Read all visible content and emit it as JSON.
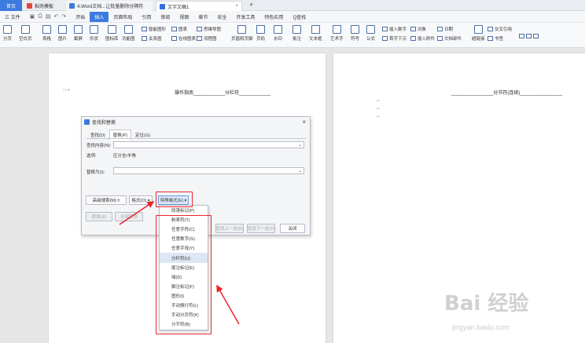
{
  "tabs": {
    "home": "首页",
    "t1": "稻壳模板",
    "t2": "4.Word文档...让批量删除分隔符",
    "t3": "文字文稿1",
    "new_tab": "+"
  },
  "menu": {
    "file": "三 文件",
    "items": [
      "开始",
      "插入",
      "页面布局",
      "引用",
      "审阅",
      "视图",
      "章节",
      "安全",
      "开发工具",
      "特色应用"
    ],
    "active": "插入",
    "search": "Q查找"
  },
  "ribbon": {
    "big": [
      "分页",
      "空白页",
      "表格",
      "图片",
      "截屏",
      "形状",
      "图标库",
      "功能图",
      "页眉和页脚",
      "页码",
      "水印",
      "批注",
      "文本框",
      "艺术字",
      "符号",
      "公式"
    ],
    "small": [
      "智能图形",
      "图表",
      "思维导图",
      "关系图",
      "在线图表",
      "流程图",
      "插入数字",
      "对象",
      "首字下沉",
      "插入附件",
      "日期",
      "文档部件",
      "超链接",
      "书签",
      "交叉引用"
    ]
  },
  "document": {
    "left_title": "操作指南____________分栏符____________",
    "right_title": "________________分节符(连续)________________"
  },
  "dialog": {
    "title": "查找和替换",
    "tabs": [
      "查找(D)",
      "替换(P)",
      "定位(G)"
    ],
    "active_tab": "替换(P)",
    "find_label": "查找内容(N):",
    "options_label": "选项:",
    "options_value": "区分全/半角",
    "replace_label": "替换为(I):",
    "buttons": {
      "advanced": "高级搜索(M) ±",
      "format": "格式(O) ▾",
      "special": "特殊格式(E) ▾",
      "replace": "替换(R)",
      "replace_all": "全部替换",
      "find_prev": "查找上一处(B)",
      "find_next": "查找下一处(F)",
      "close": "关闭"
    }
  },
  "special_menu": {
    "items": [
      "段落标记(P)",
      "制表符(T)",
      "任意字符(C)",
      "任意数字(G)",
      "任意字母(Y)",
      "分栏符(U)",
      "尾注标记(E)",
      "域(D)",
      "脚注标记(F)",
      "图形(I)",
      "手动换行符(L)",
      "手动分页符(K)",
      "分节符(B)"
    ],
    "highlighted": "分栏符(U)"
  },
  "watermark": {
    "big": "Bai 经验",
    "small": "jingyan.baidu.com"
  },
  "colors": {
    "accent": "#3b7be0",
    "annotation": "#e8262a"
  }
}
